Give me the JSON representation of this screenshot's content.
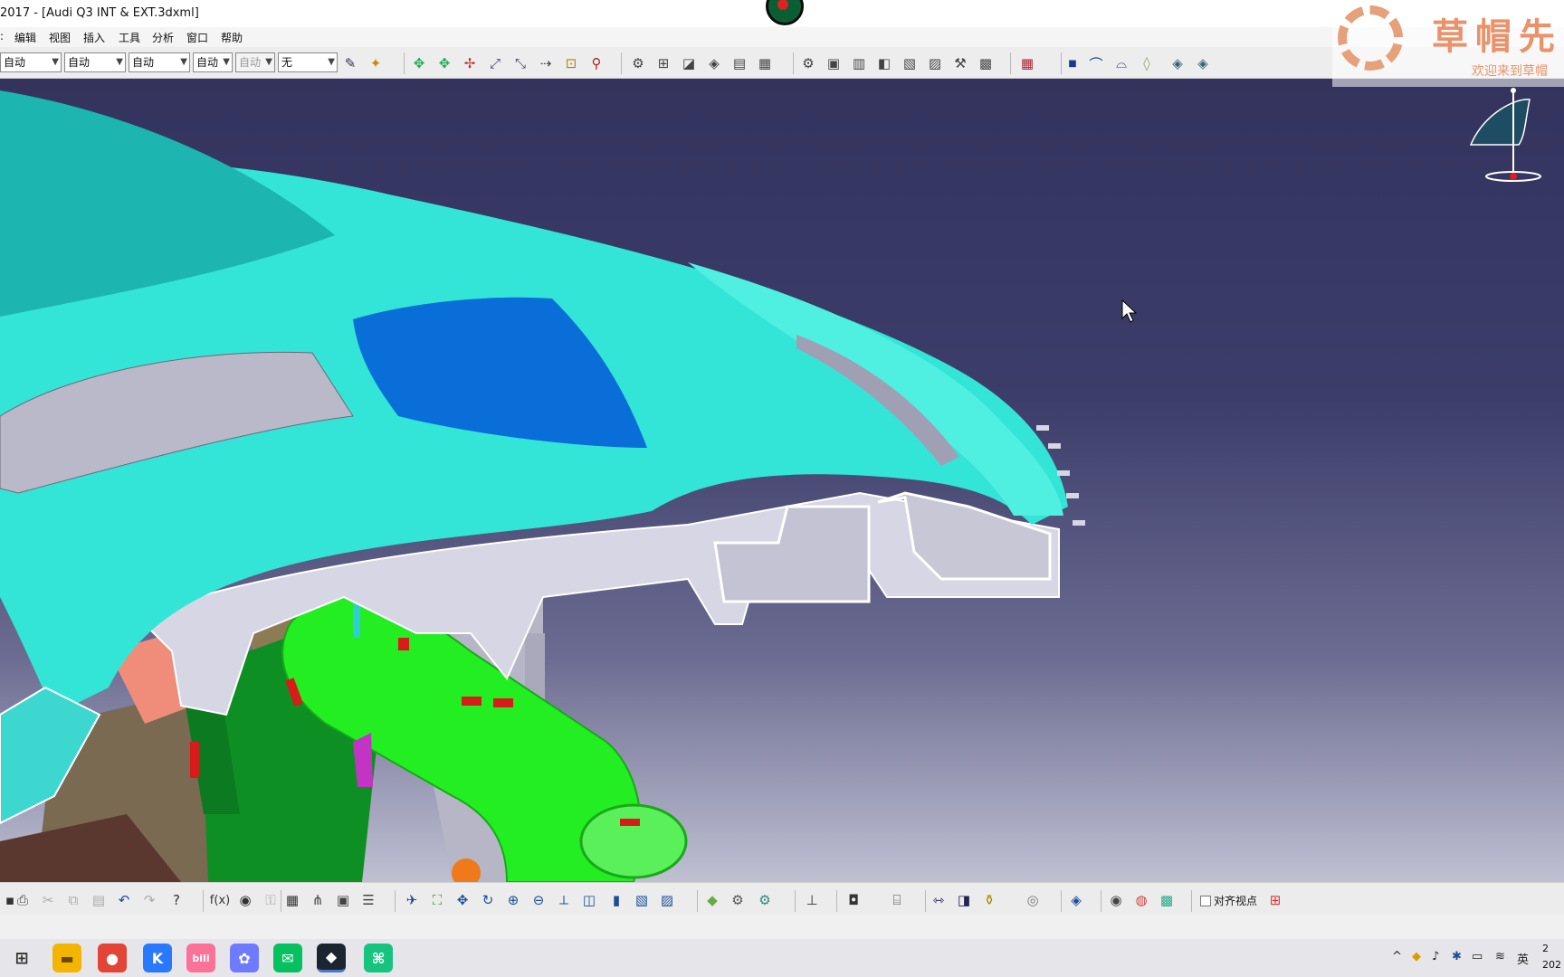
{
  "window": {
    "title": "2017 - [Audi Q3 INT & EXT.3dxml]"
  },
  "menu": {
    "items": [
      "编辑",
      "视图",
      "插入",
      "工具",
      "分析",
      "窗口",
      "帮助"
    ]
  },
  "toolbar_top": {
    "combos": [
      {
        "value": "自动"
      },
      {
        "value": "自动"
      },
      {
        "value": "自动"
      },
      {
        "value": "自动"
      },
      {
        "value": "自动"
      },
      {
        "value": "无"
      }
    ]
  },
  "viewport": {
    "colors": {
      "bg_top": "#33335e",
      "bg_bottom": "#bfc0d2",
      "dash_surface": "#33e5d7",
      "duct": "#22ee22",
      "glass": "#0a6ed9",
      "section": "#d6d6e4"
    }
  },
  "watermark": {
    "title": "草帽先",
    "subtitle": "欢迎来到草帽"
  },
  "compass": {
    "icon": "compass-icon"
  },
  "toolbar_bottom": {
    "snap_label": "对齐视点"
  },
  "taskbar": {
    "apps": [
      {
        "name": "task-view",
        "glyph": "⊞",
        "color": "#333333"
      },
      {
        "name": "file-explorer",
        "glyph": "▬",
        "color": "#f2b600"
      },
      {
        "name": "chrome",
        "glyph": "●",
        "color": "#e24436"
      },
      {
        "name": "kugou",
        "glyph": "K",
        "color": "#2979ff"
      },
      {
        "name": "bilibili",
        "glyph": "bili",
        "color": "#fb7299"
      },
      {
        "name": "app-flower",
        "glyph": "✿",
        "color": "#6f7bff"
      },
      {
        "name": "wechat",
        "glyph": "✉",
        "color": "#07c160"
      },
      {
        "name": "catia",
        "glyph": "◆",
        "color": "#1c2430"
      },
      {
        "name": "app-green",
        "glyph": "⌘",
        "color": "#16c47f"
      }
    ],
    "tray": {
      "ime": "英"
    },
    "clock": {
      "time": "2",
      "date": "202"
    }
  }
}
